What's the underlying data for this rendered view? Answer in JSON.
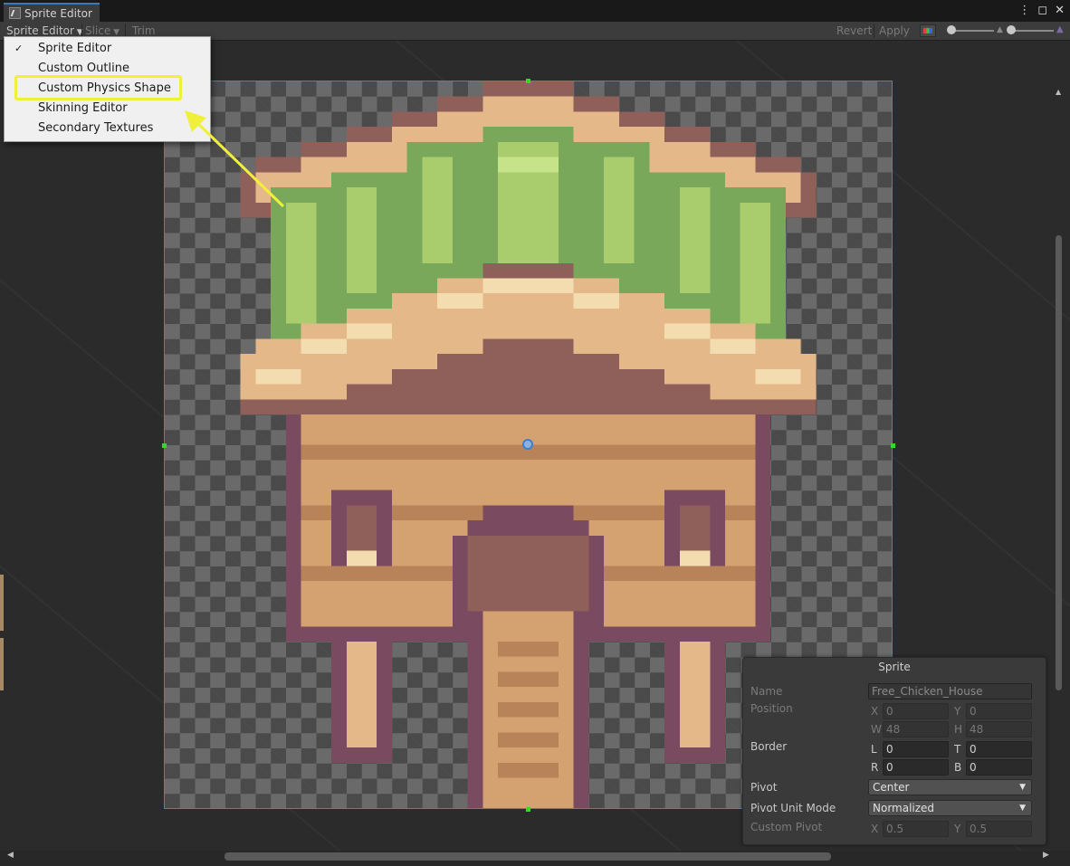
{
  "window": {
    "title": "Sprite Editor",
    "menu_icon": "kebab-icon",
    "maximize_icon": "maximize-icon",
    "close_icon": "close-icon"
  },
  "toolbar": {
    "mode_label": "Sprite Editor",
    "slice_label": "Slice",
    "trim_label": "Trim",
    "revert_label": "Revert",
    "apply_label": "Apply"
  },
  "menu": {
    "items": [
      {
        "label": "Sprite Editor",
        "checked": true
      },
      {
        "label": "Custom Outline",
        "checked": false
      },
      {
        "label": "Custom Physics Shape",
        "checked": false
      },
      {
        "label": "Skinning Editor",
        "checked": false
      },
      {
        "label": "Secondary Textures",
        "checked": false
      }
    ],
    "check_mark": "✓",
    "highlighted_item": "Custom Physics Shape",
    "highlight_color": "#f0f03a"
  },
  "inspector": {
    "title": "Sprite",
    "name_label": "Name",
    "name_value": "Free_Chicken_House",
    "position_label": "Position",
    "x_label": "X",
    "x_value": "0",
    "y_label": "Y",
    "y_value": "0",
    "w_label": "W",
    "w_value": "48",
    "h_label": "H",
    "h_value": "48",
    "border_label": "Border",
    "l_label": "L",
    "l_value": "0",
    "t_label": "T",
    "t_value": "0",
    "r_label": "R",
    "r_value": "0",
    "b_label": "B",
    "b_value": "0",
    "pivot_label": "Pivot",
    "pivot_value": "Center",
    "pivot_unit_label": "Pivot Unit Mode",
    "pivot_unit_value": "Normalized",
    "custom_pivot_label": "Custom Pivot",
    "cx_label": "X",
    "cx_value": "0.5",
    "cy_label": "Y",
    "cy_value": "0.5"
  },
  "colors": {
    "accent": "#3a79bb",
    "handle": "#37d637",
    "roof_light": "#e4b888",
    "roof_cream": "#f2dcb0",
    "roof_dark": "#8f5f5a",
    "leaf_green": "#a9cd6c",
    "leaf_dark": "#7aa85a",
    "wall": "#d3a270",
    "wall_dark": "#b88358",
    "trim": "#7a4a60"
  }
}
